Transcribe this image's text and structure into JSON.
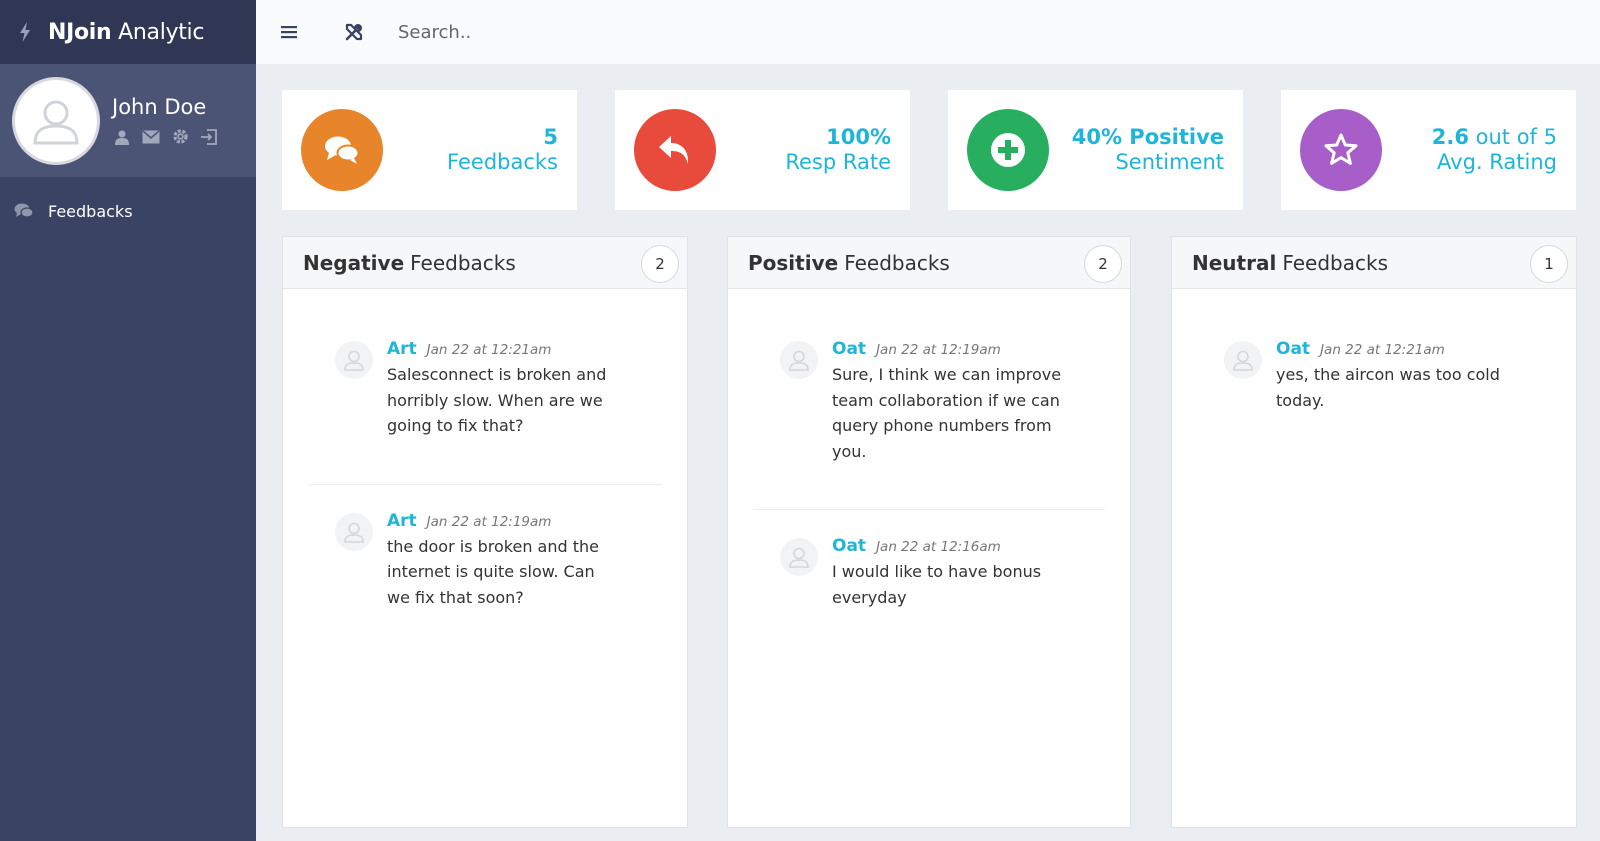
{
  "app": {
    "brand_bold": "NJoin",
    "brand_rest": " Analytic"
  },
  "user": {
    "name": "John Doe"
  },
  "nav": {
    "items": [
      {
        "label": "Feedbacks",
        "icon": "comments-icon"
      }
    ]
  },
  "topbar": {
    "search_placeholder": "Search.."
  },
  "stats": [
    {
      "value": "5",
      "suffix": "",
      "label": "Feedbacks",
      "color": "#e8842a",
      "icon": "comments-icon"
    },
    {
      "value": "100%",
      "suffix": "",
      "label": "Resp Rate",
      "color": "#e84a3c",
      "icon": "reply-icon"
    },
    {
      "value": "40% Positive",
      "suffix": "",
      "label": "Sentiment",
      "color": "#27ae5f",
      "icon": "plus-circle-icon"
    },
    {
      "value": "2.6",
      "suffix": " out of 5",
      "label": "Avg. Rating",
      "color": "#a85ec8",
      "icon": "star-icon"
    }
  ],
  "panels": [
    {
      "title_bold": "Negative",
      "title_rest": "Feedbacks",
      "count": "2",
      "items": [
        {
          "author": "Art",
          "time": "Jan 22 at 12:21am",
          "text": "Salesconnect is broken and horribly slow. When are we going to fix that?"
        },
        {
          "author": "Art",
          "time": "Jan 22 at 12:19am",
          "text": "the door is broken and the internet is quite slow. Can we fix that soon?"
        }
      ]
    },
    {
      "title_bold": "Positive",
      "title_rest": "Feedbacks",
      "count": "2",
      "items": [
        {
          "author": "Oat",
          "time": "Jan 22 at 12:19am",
          "text": "Sure, I think we can improve team collaboration if we can query phone numbers from you."
        },
        {
          "author": "Oat",
          "time": "Jan 22 at 12:16am",
          "text": "I would like to have bonus everyday"
        }
      ]
    },
    {
      "title_bold": "Neutral",
      "title_rest": "Feedbacks",
      "count": "1",
      "items": [
        {
          "author": "Oat",
          "time": "Jan 22 at 12:21am",
          "text": "yes, the aircon was too cold today."
        }
      ]
    }
  ]
}
